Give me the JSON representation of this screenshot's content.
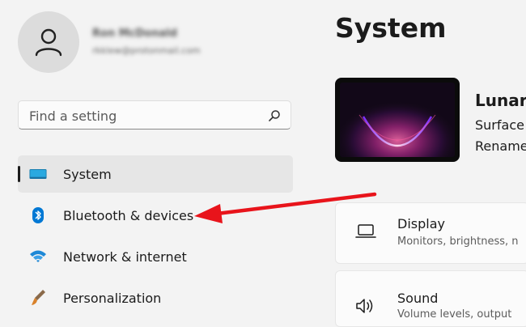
{
  "user": {
    "name": "Ron McDonald",
    "email": "rkklew@protonmail.com"
  },
  "search": {
    "placeholder": "Find a setting",
    "icon": "search-icon"
  },
  "nav": {
    "items": [
      {
        "label": "System",
        "icon": "system-display-icon",
        "active": true
      },
      {
        "label": "Bluetooth & devices",
        "icon": "bluetooth-icon",
        "active": false
      },
      {
        "label": "Network & internet",
        "icon": "wifi-icon",
        "active": false
      },
      {
        "label": "Personalization",
        "icon": "paintbrush-icon",
        "active": false
      }
    ]
  },
  "main": {
    "title": "System",
    "device": {
      "name": "Lunari",
      "model": "Surface",
      "rename": "Rename"
    },
    "cards": [
      {
        "title": "Display",
        "subtitle": "Monitors, brightness, n",
        "icon": "laptop-icon"
      },
      {
        "title": "Sound",
        "subtitle": "Volume levels, output",
        "icon": "speaker-icon"
      }
    ]
  },
  "annotation": {
    "color": "#e8141b"
  },
  "colors": {
    "background": "#f3f3f3",
    "accent_blue": "#0067c0"
  }
}
